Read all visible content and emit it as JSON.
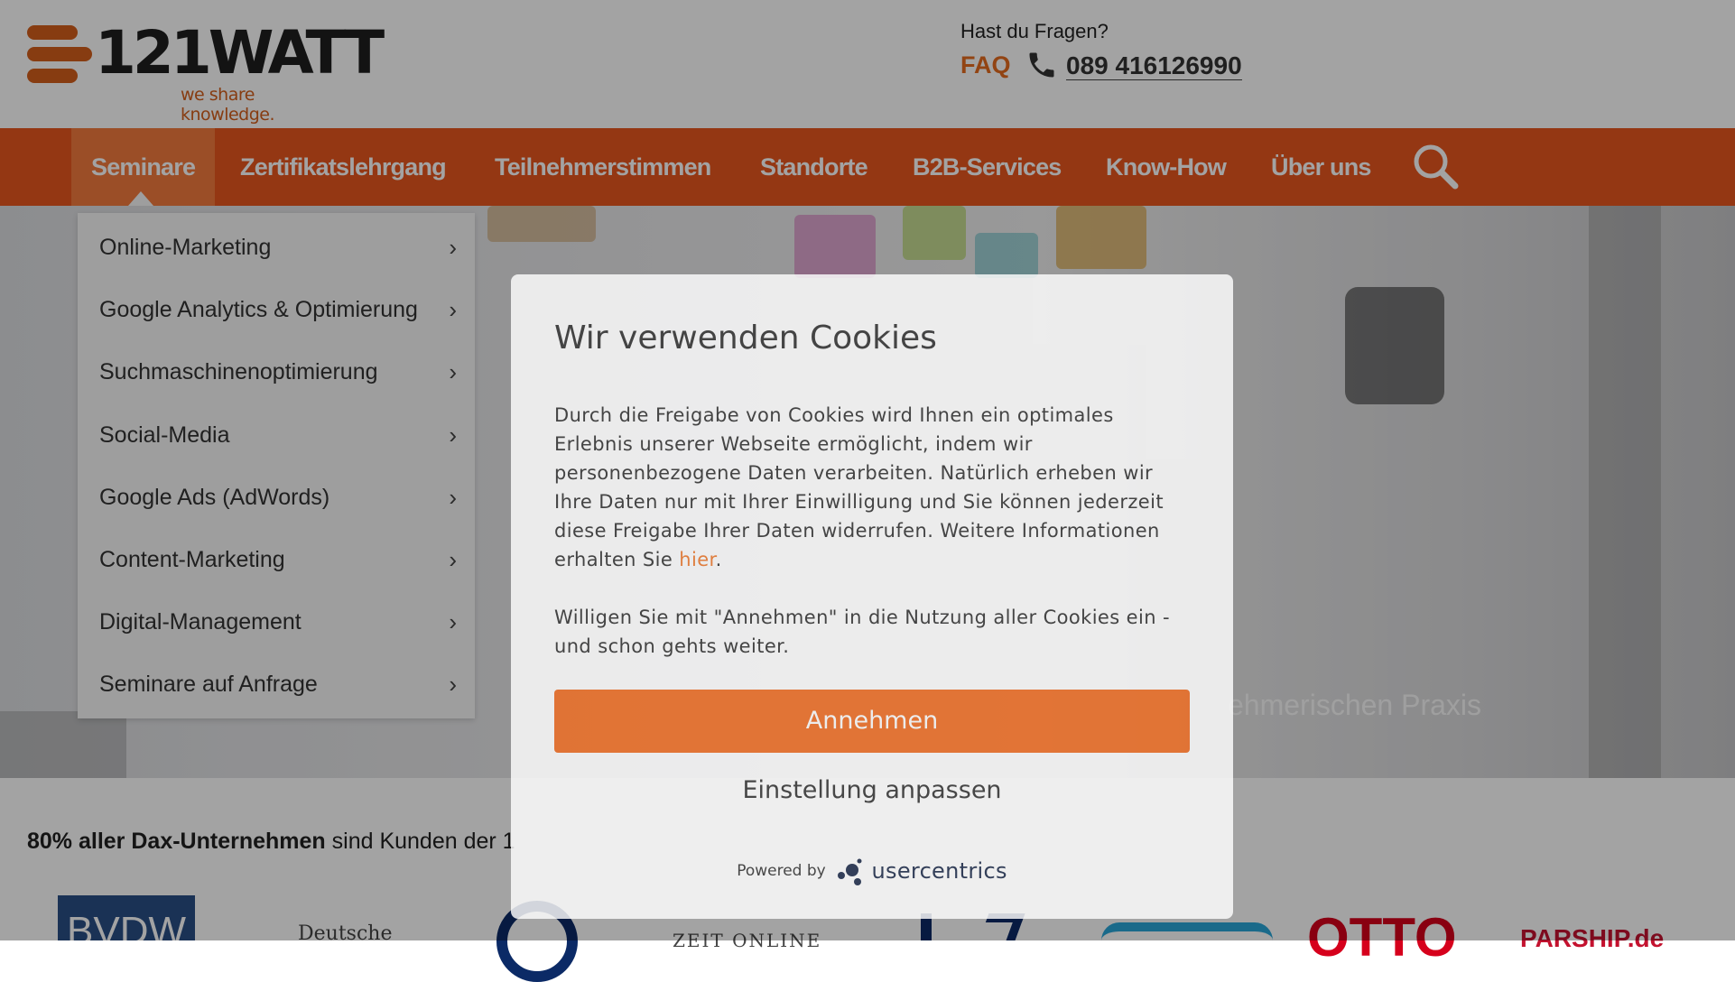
{
  "header": {
    "logo_text": "121WATT",
    "logo_tagline": "we share knowledge.",
    "contact_question": "Hast du Fragen?",
    "faq_label": "FAQ",
    "phone_number": "089 416126990"
  },
  "nav": {
    "items": [
      {
        "label": "Seminare"
      },
      {
        "label": "Zertifikatslehrgang"
      },
      {
        "label": "Teilnehmerstimmen"
      },
      {
        "label": "Standorte"
      },
      {
        "label": "B2B-Services"
      },
      {
        "label": "Know-How"
      },
      {
        "label": "Über uns"
      }
    ]
  },
  "dropdown": {
    "items": [
      {
        "label": "Online-Marketing"
      },
      {
        "label": "Google Analytics & Optimierung"
      },
      {
        "label": "Suchmaschinenoptimierung"
      },
      {
        "label": "Social-Media"
      },
      {
        "label": "Google Ads (AdWords)"
      },
      {
        "label": "Content-Marketing"
      },
      {
        "label": "Digital-Management"
      },
      {
        "label": "Seminare auf Anfrage"
      }
    ],
    "chevron": "›"
  },
  "hero": {
    "subtitle_partial": "ehmerischen Praxis"
  },
  "customers": {
    "bold": "80% aller Dax-Unternehmen",
    "rest": " sind Kunden der 1"
  },
  "brands": [
    "BVDW",
    "Deutsche",
    "ZEIT ONLINE",
    "OTTO",
    "PARSHIP.de"
  ],
  "cookie_modal": {
    "title": "Wir verwenden Cookies",
    "body_text": "Durch die Freigabe von Cookies wird Ihnen ein optimales Erlebnis unserer Webseite ermöglicht, indem wir personenbezogene Daten verarbeiten. Natürlich erheben wir Ihre Daten nur mit Ihrer Einwilligung und Sie können jederzeit diese Freigabe Ihrer Daten widerrufen. Weitere Informationen erhalten Sie ",
    "link_label": "hier",
    "body_end": ".",
    "body2": "Willigen Sie mit \"Annehmen\" in die Nutzung aller Cookies ein - und schon gehts weiter.",
    "accept_label": "Annehmen",
    "settings_label": "Einstellung anpassen",
    "powered_by": "Powered by",
    "provider": "usercentrics"
  },
  "colors": {
    "brand_orange": "#e8561f",
    "accept_orange": "#f26d21",
    "link_orange": "#f07a2e"
  }
}
